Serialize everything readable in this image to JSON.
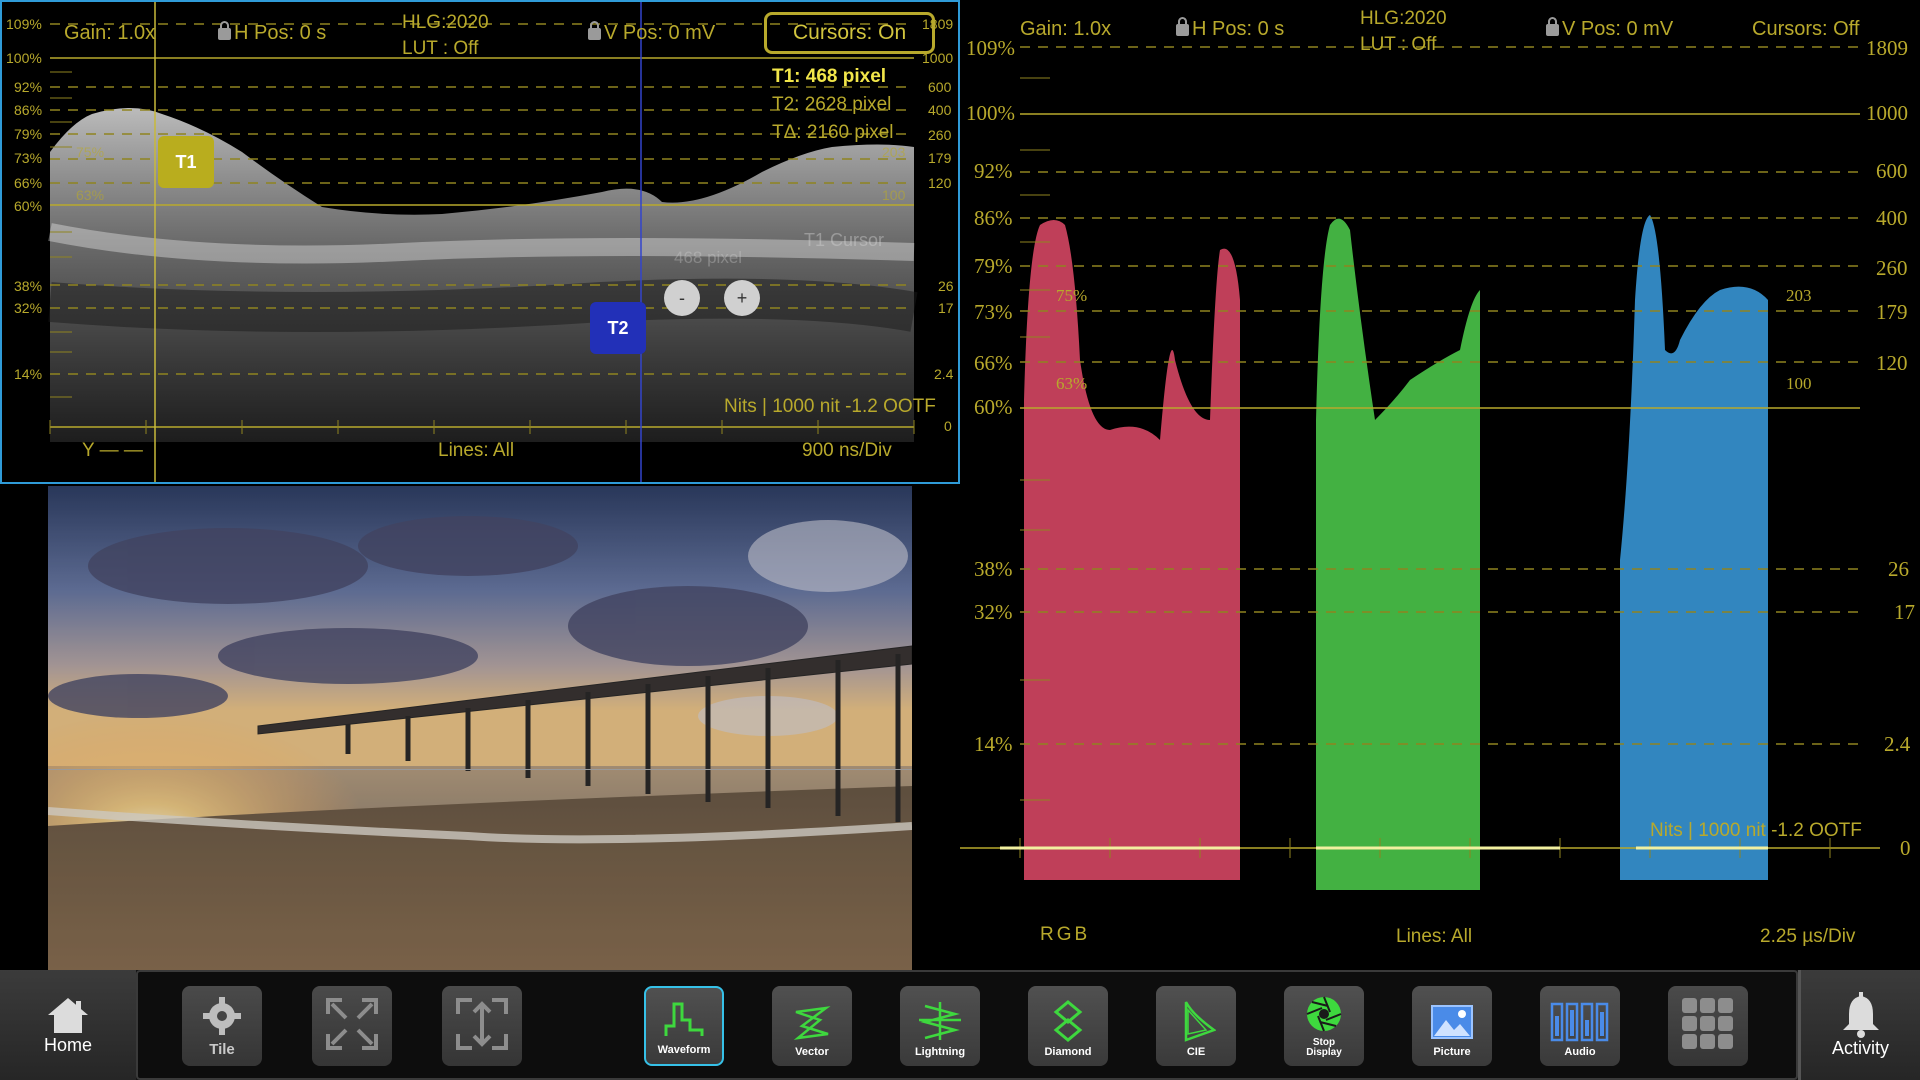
{
  "left_waveform": {
    "gain": "Gain: 1.0x",
    "h_pos": "H Pos: 0 s",
    "colorspace": "HLG:2020",
    "lut": "LUT : Off",
    "v_pos": "V Pos: 0 mV",
    "cursors": "Cursors: On",
    "t1_readout": "T1: 468 pixel",
    "t2_readout": "T2: 2628 pixel",
    "delta_readout": "TΔ: 2160 pixel",
    "t1_tag": "T1",
    "t2_tag": "T2",
    "t1_cursor_label": "T1 Cursor",
    "cursor_value_ghost": "468 pixel",
    "minus": "-",
    "plus": "+",
    "left_scale": [
      "109%",
      "100%",
      "92%",
      "86%",
      "79%",
      "73%",
      "66%",
      "60%",
      "38%",
      "32%",
      "14%"
    ],
    "right_scale": [
      "1809",
      "1000",
      "600",
      "400",
      "260",
      "179",
      "120",
      "26",
      "17",
      "2.4",
      "0"
    ],
    "ref_75": "75%",
    "ref_63": "63%",
    "ref_203": "203",
    "ref_100": "100",
    "nits_note": "Nits | 1000 nit -1.2 OOTF",
    "channel": "Y",
    "lines": "Lines: All",
    "timebase": "900 ns/Div"
  },
  "right_waveform": {
    "gain": "Gain: 1.0x",
    "h_pos": "H Pos: 0 s",
    "colorspace": "HLG:2020",
    "lut": "LUT : Off",
    "v_pos": "V Pos: 0 mV",
    "cursors": "Cursors: Off",
    "left_scale": [
      "109%",
      "100%",
      "92%",
      "86%",
      "79%",
      "73%",
      "66%",
      "60%",
      "38%",
      "32%",
      "14%"
    ],
    "right_scale": [
      "1809",
      "1000",
      "600",
      "400",
      "260",
      "179",
      "120",
      "26",
      "17",
      "2.4",
      "0"
    ],
    "ref_75": "75%",
    "ref_63": "63%",
    "ref_203": "203",
    "ref_100": "100",
    "nits_note": "Nits | 1000 nit -1.2 OOTF",
    "channel": "RGB",
    "lines": "Lines: All",
    "timebase": "2.25 µs/Div",
    "colors": {
      "red": "#e04a68",
      "green": "#4fd04e",
      "blue": "#3b9de0"
    }
  },
  "toolbar": {
    "home": "Home",
    "tile": "Tile",
    "waveform": "Waveform",
    "vector": "Vector",
    "lightning": "Lightning",
    "diamond": "Diamond",
    "cie": "CIE",
    "stop_display": "Stop\nDisplay",
    "picture": "Picture",
    "audio": "Audio",
    "activity": "Activity",
    "accent": "#36c1e8"
  }
}
